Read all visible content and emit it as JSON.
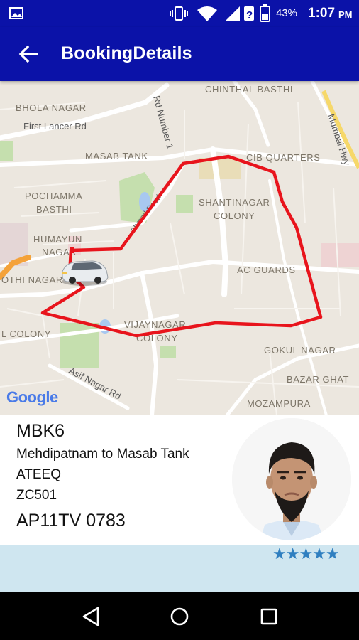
{
  "status_bar": {
    "battery": "43%",
    "time": "1:07",
    "ampm": "PM"
  },
  "app_bar": {
    "title": "BookingDetails"
  },
  "map": {
    "labels": [
      "CHINTHAL BASTHI",
      "BHOLA NAGAR",
      "First Lancer Rd",
      "Rd Number 1",
      "MASAB TANK",
      "CIB QUARTERS",
      "Mumbai Hwy",
      "POCHAMMA",
      "BASTHI",
      "SHANTINAGAR",
      "COLONY",
      "HUMAYUN",
      "NAGAR",
      "Ahmed Road",
      "AC GUARDS",
      "OTHI NAGAR",
      "VIJAYNAGAR",
      "COLONY",
      "L COLONY",
      "GOKUL NAGAR",
      "BAZAR GHAT",
      "Asif Nagar Rd",
      "MOZAMPURA"
    ],
    "logo": "Google"
  },
  "booking": {
    "id": "MBK6",
    "route": "Mehdipatnam to Masab Tank",
    "driver_name": "ATEEQ",
    "driver_code": "ZC501",
    "vehicle_number": "AP11TV 0783",
    "rating_stars": "★★★★★",
    "rating": 5
  },
  "colors": {
    "primary": "#0b12a8",
    "route": "#e8141c",
    "rating_band": "#cfe6f0",
    "star": "#2f7fc0"
  }
}
